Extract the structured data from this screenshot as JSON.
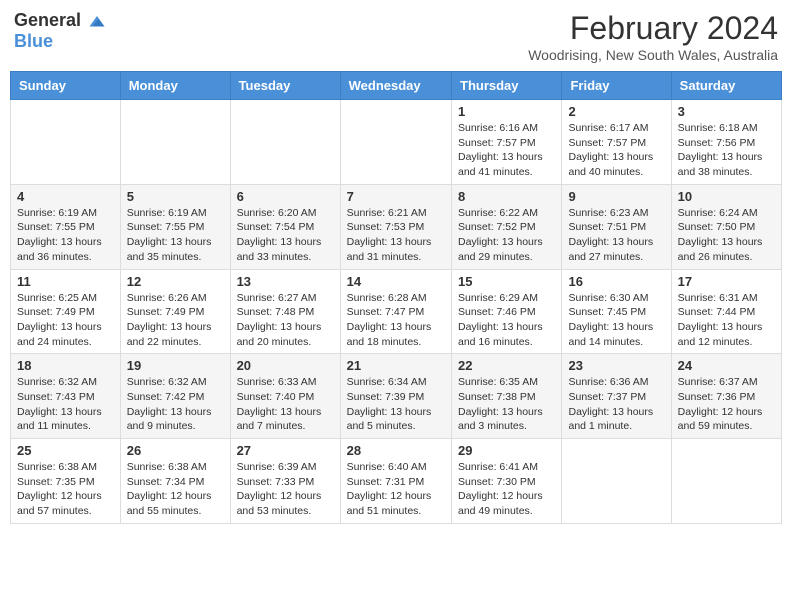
{
  "header": {
    "logo_general": "General",
    "logo_blue": "Blue",
    "title": "February 2024",
    "subtitle": "Woodrising, New South Wales, Australia"
  },
  "calendar": {
    "days_of_week": [
      "Sunday",
      "Monday",
      "Tuesday",
      "Wednesday",
      "Thursday",
      "Friday",
      "Saturday"
    ],
    "weeks": [
      [
        {
          "day": "",
          "info": ""
        },
        {
          "day": "",
          "info": ""
        },
        {
          "day": "",
          "info": ""
        },
        {
          "day": "",
          "info": ""
        },
        {
          "day": "1",
          "info": "Sunrise: 6:16 AM\nSunset: 7:57 PM\nDaylight: 13 hours and 41 minutes."
        },
        {
          "day": "2",
          "info": "Sunrise: 6:17 AM\nSunset: 7:57 PM\nDaylight: 13 hours and 40 minutes."
        },
        {
          "day": "3",
          "info": "Sunrise: 6:18 AM\nSunset: 7:56 PM\nDaylight: 13 hours and 38 minutes."
        }
      ],
      [
        {
          "day": "4",
          "info": "Sunrise: 6:19 AM\nSunset: 7:55 PM\nDaylight: 13 hours and 36 minutes."
        },
        {
          "day": "5",
          "info": "Sunrise: 6:19 AM\nSunset: 7:55 PM\nDaylight: 13 hours and 35 minutes."
        },
        {
          "day": "6",
          "info": "Sunrise: 6:20 AM\nSunset: 7:54 PM\nDaylight: 13 hours and 33 minutes."
        },
        {
          "day": "7",
          "info": "Sunrise: 6:21 AM\nSunset: 7:53 PM\nDaylight: 13 hours and 31 minutes."
        },
        {
          "day": "8",
          "info": "Sunrise: 6:22 AM\nSunset: 7:52 PM\nDaylight: 13 hours and 29 minutes."
        },
        {
          "day": "9",
          "info": "Sunrise: 6:23 AM\nSunset: 7:51 PM\nDaylight: 13 hours and 27 minutes."
        },
        {
          "day": "10",
          "info": "Sunrise: 6:24 AM\nSunset: 7:50 PM\nDaylight: 13 hours and 26 minutes."
        }
      ],
      [
        {
          "day": "11",
          "info": "Sunrise: 6:25 AM\nSunset: 7:49 PM\nDaylight: 13 hours and 24 minutes."
        },
        {
          "day": "12",
          "info": "Sunrise: 6:26 AM\nSunset: 7:49 PM\nDaylight: 13 hours and 22 minutes."
        },
        {
          "day": "13",
          "info": "Sunrise: 6:27 AM\nSunset: 7:48 PM\nDaylight: 13 hours and 20 minutes."
        },
        {
          "day": "14",
          "info": "Sunrise: 6:28 AM\nSunset: 7:47 PM\nDaylight: 13 hours and 18 minutes."
        },
        {
          "day": "15",
          "info": "Sunrise: 6:29 AM\nSunset: 7:46 PM\nDaylight: 13 hours and 16 minutes."
        },
        {
          "day": "16",
          "info": "Sunrise: 6:30 AM\nSunset: 7:45 PM\nDaylight: 13 hours and 14 minutes."
        },
        {
          "day": "17",
          "info": "Sunrise: 6:31 AM\nSunset: 7:44 PM\nDaylight: 13 hours and 12 minutes."
        }
      ],
      [
        {
          "day": "18",
          "info": "Sunrise: 6:32 AM\nSunset: 7:43 PM\nDaylight: 13 hours and 11 minutes."
        },
        {
          "day": "19",
          "info": "Sunrise: 6:32 AM\nSunset: 7:42 PM\nDaylight: 13 hours and 9 minutes."
        },
        {
          "day": "20",
          "info": "Sunrise: 6:33 AM\nSunset: 7:40 PM\nDaylight: 13 hours and 7 minutes."
        },
        {
          "day": "21",
          "info": "Sunrise: 6:34 AM\nSunset: 7:39 PM\nDaylight: 13 hours and 5 minutes."
        },
        {
          "day": "22",
          "info": "Sunrise: 6:35 AM\nSunset: 7:38 PM\nDaylight: 13 hours and 3 minutes."
        },
        {
          "day": "23",
          "info": "Sunrise: 6:36 AM\nSunset: 7:37 PM\nDaylight: 13 hours and 1 minute."
        },
        {
          "day": "24",
          "info": "Sunrise: 6:37 AM\nSunset: 7:36 PM\nDaylight: 12 hours and 59 minutes."
        }
      ],
      [
        {
          "day": "25",
          "info": "Sunrise: 6:38 AM\nSunset: 7:35 PM\nDaylight: 12 hours and 57 minutes."
        },
        {
          "day": "26",
          "info": "Sunrise: 6:38 AM\nSunset: 7:34 PM\nDaylight: 12 hours and 55 minutes."
        },
        {
          "day": "27",
          "info": "Sunrise: 6:39 AM\nSunset: 7:33 PM\nDaylight: 12 hours and 53 minutes."
        },
        {
          "day": "28",
          "info": "Sunrise: 6:40 AM\nSunset: 7:31 PM\nDaylight: 12 hours and 51 minutes."
        },
        {
          "day": "29",
          "info": "Sunrise: 6:41 AM\nSunset: 7:30 PM\nDaylight: 12 hours and 49 minutes."
        },
        {
          "day": "",
          "info": ""
        },
        {
          "day": "",
          "info": ""
        }
      ]
    ]
  }
}
